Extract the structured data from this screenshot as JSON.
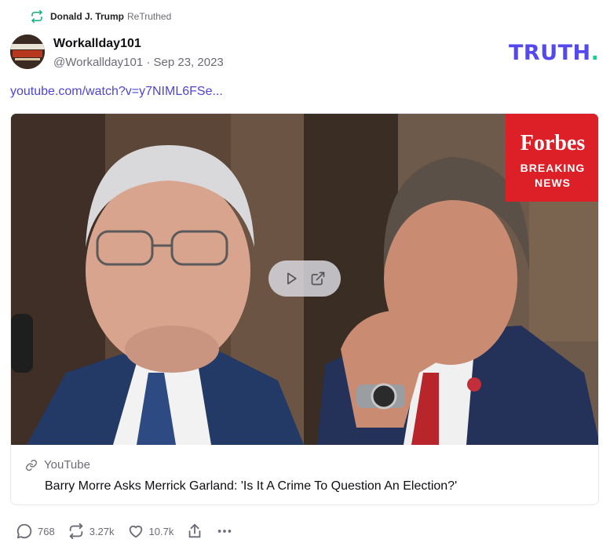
{
  "retruth": {
    "name": "Donald J. Trump",
    "suffix": "ReTruthed",
    "icon": "retruth-icon",
    "icon_color": "#0fb27a"
  },
  "post": {
    "display_name": "Workallday101",
    "handle": "@Workallday101",
    "separator": "·",
    "date": "Sep 23, 2023",
    "link_text": "youtube.com/watch?v=y7NIML6FSe..."
  },
  "brand": {
    "name": "TRUTH",
    "dot": ".",
    "color": "#5448ee",
    "dot_color": "#0fd38f"
  },
  "card": {
    "source": "YouTube",
    "title": "Barry Morre Asks Merrick Garland: 'Is It A Crime To Question An Election?'",
    "thumb_badge": {
      "brand": "Forbes",
      "line1": "BREAKING",
      "line2": "NEWS"
    }
  },
  "actions": {
    "replies": "768",
    "retruths": "3.27k",
    "likes": "10.7k"
  }
}
